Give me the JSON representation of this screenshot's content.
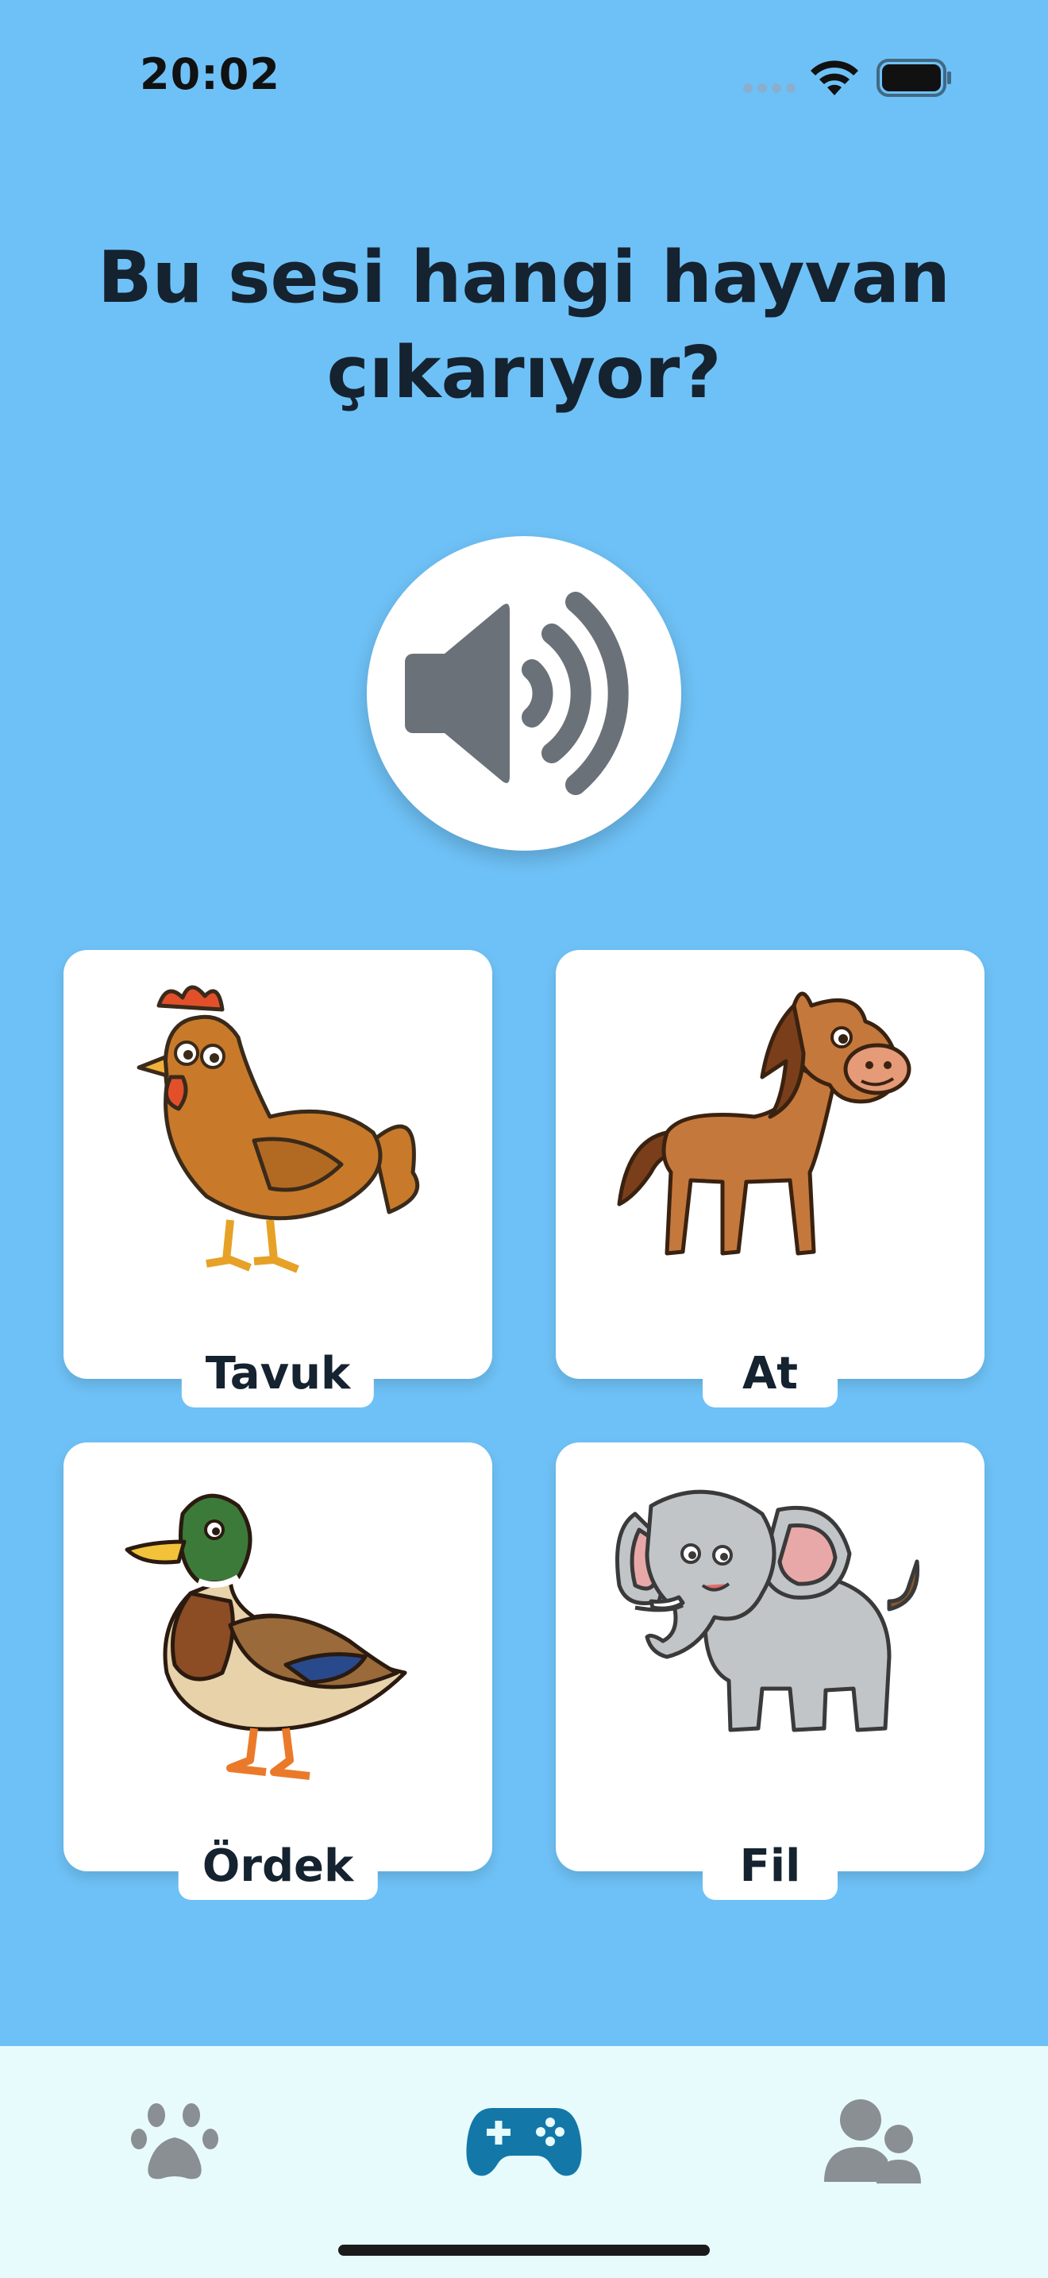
{
  "status_bar": {
    "time": "20:02",
    "icons": [
      "cellular-signal-icon",
      "wifi-icon",
      "battery-icon"
    ]
  },
  "question": {
    "line1": "Bu sesi hangi hayvan",
    "line2": "çıkarıyor?"
  },
  "sound_button": {
    "icon": "speaker-volume-icon"
  },
  "options": [
    {
      "label": "Tavuk",
      "icon": "chicken-illustration"
    },
    {
      "label": "At",
      "icon": "horse-illustration"
    },
    {
      "label": "Ördek",
      "icon": "duck-illustration"
    },
    {
      "label": "Fil",
      "icon": "elephant-illustration"
    }
  ],
  "tab_bar": {
    "items": [
      {
        "icon": "paw-icon",
        "active": false
      },
      {
        "icon": "gamepad-icon",
        "active": true
      },
      {
        "icon": "users-icon",
        "active": false
      }
    ]
  },
  "colors": {
    "background": "#6ec1f6",
    "tab_bar": "#e7fbfc",
    "active_tab": "#1378a8",
    "inactive_tab": "#8a8f94",
    "speaker": "#6b7178"
  }
}
